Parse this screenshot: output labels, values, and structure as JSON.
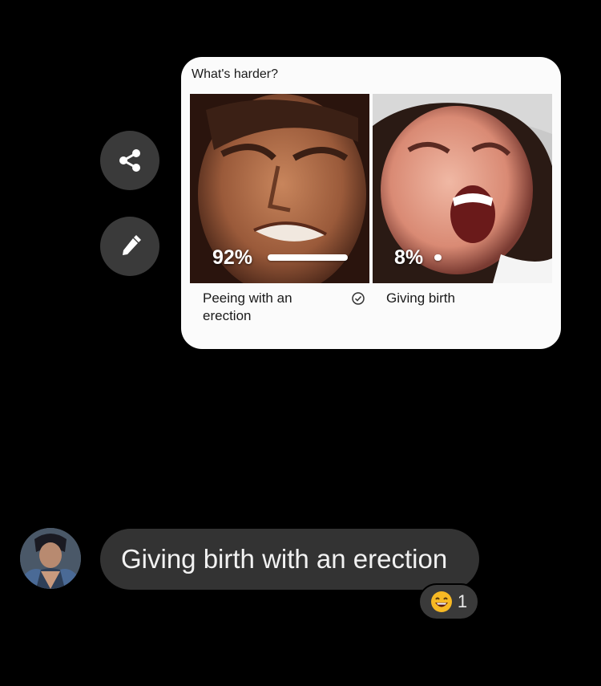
{
  "side_actions": {
    "share_icon": "share-icon",
    "edit_icon": "pencil-icon"
  },
  "poll": {
    "question": "What's harder?",
    "options": [
      {
        "label": "Peeing with an erection",
        "percent_text": "92%",
        "percent": 92,
        "selected": true,
        "image_description_icon": "grimacing-man-photo"
      },
      {
        "label": "Giving birth",
        "percent_text": "8%",
        "percent": 8,
        "selected": false,
        "image_description_icon": "screaming-woman-photo"
      }
    ]
  },
  "message": {
    "text": "Giving birth with an erection",
    "reaction": {
      "emoji": "😄",
      "count": "1"
    }
  },
  "colors": {
    "background": "#000000",
    "bubble": "#333333",
    "card": "#fbfbfb",
    "button": "#3a3a3a"
  }
}
